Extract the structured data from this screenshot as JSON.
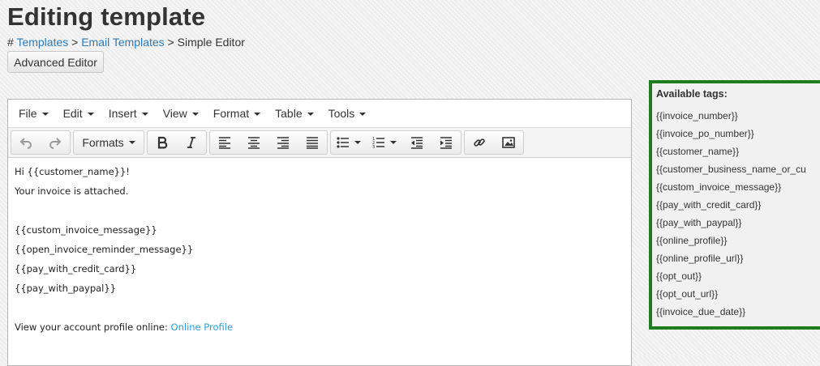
{
  "page": {
    "title": "Editing template"
  },
  "breadcrumb": {
    "prefix": "# ",
    "items": [
      "Templates",
      "Email Templates"
    ],
    "separator": " > ",
    "current": "Simple Editor"
  },
  "actions": {
    "advanced_editor": "Advanced Editor"
  },
  "editor": {
    "menu": [
      "File",
      "Edit",
      "Insert",
      "View",
      "Format",
      "Table",
      "Tools"
    ],
    "toolbar": {
      "formats_label": "Formats",
      "icons": [
        "undo-icon",
        "redo-icon",
        "bold-icon",
        "italic-icon",
        "align-left-icon",
        "align-center-icon",
        "align-right-icon",
        "align-justify-icon",
        "bullet-list-icon",
        "numbered-list-icon",
        "outdent-icon",
        "indent-icon",
        "link-icon",
        "image-icon"
      ]
    },
    "content": {
      "greeting": "Hi {{customer_name}}!",
      "attached": "Your invoice is attached.",
      "custom_message": "{{custom_invoice_message}}",
      "reminder": "{{open_invoice_reminder_message}}",
      "pay_card": "{{pay_with_credit_card}}",
      "pay_paypal": "{{pay_with_paypal}}",
      "profile_text": "View your account profile online: ",
      "profile_link": "Online Profile"
    }
  },
  "tags_panel": {
    "title": "Available tags:",
    "tags": [
      "{{invoice_number}}",
      "{{invoice_po_number}}",
      "{{customer_name}}",
      "{{customer_business_name_or_cu",
      "{{custom_invoice_message}}",
      "{{pay_with_credit_card}}",
      "{{pay_with_paypal}}",
      "{{online_profile}}",
      "{{online_profile_url}}",
      "{{opt_out}}",
      "{{opt_out_url}}",
      "{{invoice_due_date}}"
    ],
    "border_color": "#1e7d1e"
  }
}
